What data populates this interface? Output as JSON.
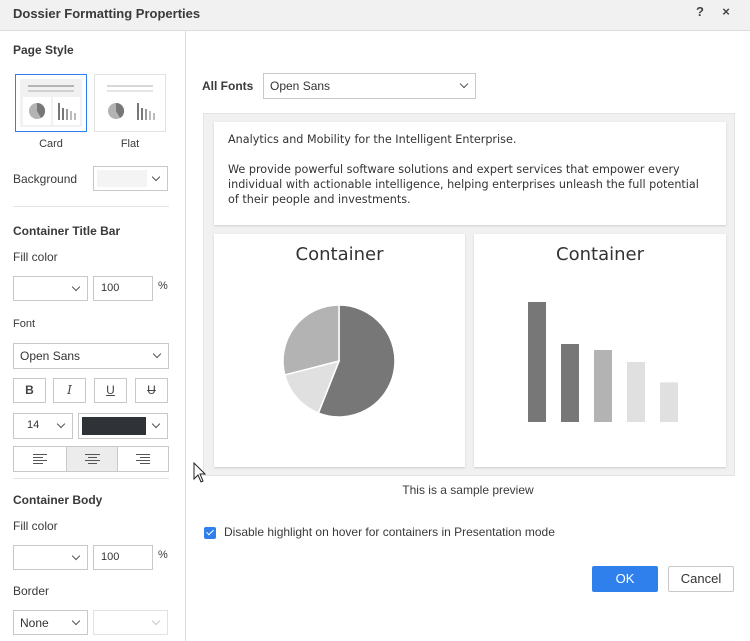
{
  "dialog": {
    "title": "Dossier Formatting Properties",
    "help_label": "?",
    "close_label": "×"
  },
  "left_panel": {
    "page_style": {
      "heading": "Page Style",
      "options": [
        {
          "label": "Card",
          "selected": true
        },
        {
          "label": "Flat",
          "selected": false
        }
      ],
      "background_label": "Background",
      "background_value": ""
    },
    "container_title_bar": {
      "heading": "Container Title Bar",
      "fill_color_label": "Fill color",
      "fill_color_value": "",
      "fill_opacity": "100",
      "percent": "%",
      "font_label": "Font",
      "font_value": "Open Sans",
      "bold": "B",
      "italic": "I",
      "underline": "U",
      "strikethrough": "U",
      "font_size": "14",
      "font_color": "#2f3237",
      "alignment_selected": "center"
    },
    "container_body": {
      "heading": "Container Body",
      "fill_color_label": "Fill color",
      "fill_color_value": "",
      "fill_opacity": "100",
      "percent": "%",
      "border_label": "Border",
      "border_value": "None"
    }
  },
  "right_panel": {
    "all_fonts_label": "All Fonts",
    "all_fonts_value": "Open Sans",
    "preview": {
      "text_line1": "Analytics and Mobility for the Intelligent Enterprise.",
      "text_line2": "We provide powerful software solutions and expert services that empower every individual with actionable intelligence, helping enterprises unleash the full potential of their people and investments.",
      "container1_title": "Container",
      "container2_title": "Container",
      "pie_slices": [
        {
          "value": 56,
          "color": "#777777"
        },
        {
          "value": 15,
          "color": "#e0e0e0"
        },
        {
          "value": 29,
          "color": "#b3b3b3"
        }
      ],
      "bars": [
        {
          "value": 100,
          "color": "#777777"
        },
        {
          "value": 65,
          "color": "#777777"
        },
        {
          "value": 60,
          "color": "#b3b3b3"
        },
        {
          "value": 50,
          "color": "#e0e0e0"
        },
        {
          "value": 33,
          "color": "#e0e0e0"
        }
      ],
      "caption": "This is a sample preview"
    },
    "disable_highlight": {
      "checked": true,
      "label": "Disable highlight on hover for containers in Presentation mode"
    },
    "ok_label": "OK",
    "cancel_label": "Cancel"
  },
  "colors": {
    "accent": "#2f80ed",
    "panel_bg": "#f1f1f1"
  }
}
